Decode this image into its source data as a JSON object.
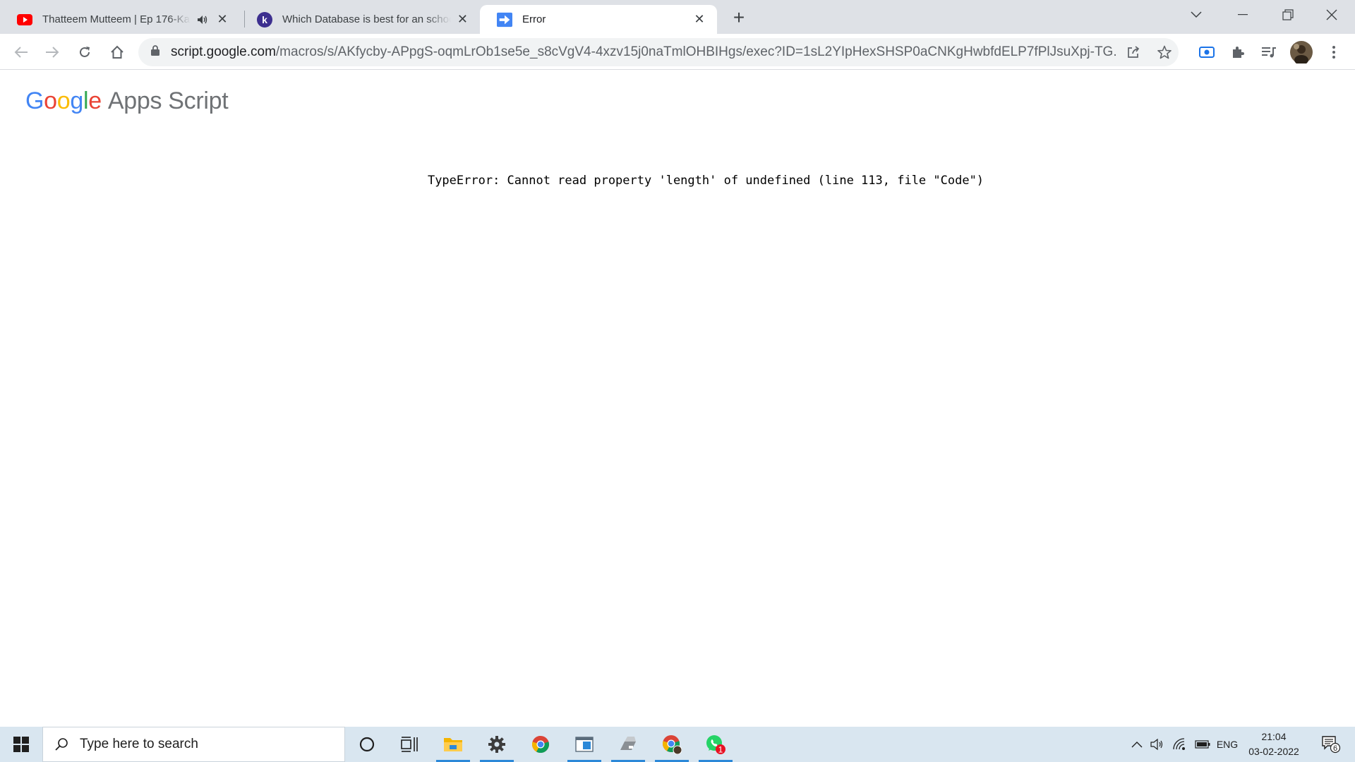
{
  "browser": {
    "tabs": [
      {
        "title": "Thatteem Mutteem | Ep 176-Ka",
        "favicon": "youtube-icon",
        "audio": true,
        "active": false
      },
      {
        "title": "Which Database is best for an school",
        "favicon": "k-letter-icon",
        "active": false
      },
      {
        "title": "Error",
        "favicon": "apps-script-arrow-icon",
        "active": true
      }
    ],
    "new_tab_label": "+",
    "address": {
      "host": "script.google.com",
      "path": "/macros/s/AKfycby-APpgS-oqmLrOb1se5e_s8cVgV4-4xzv15j0naTmlOHBIHgs/exec?ID=1sL2YIpHexSHSP0aCNKgHwbfdELP7fPlJsuXpj-TG..."
    }
  },
  "page": {
    "logo_google": [
      "G",
      "o",
      "o",
      "g",
      "l",
      "e"
    ],
    "logo_product": "Apps Script",
    "error_message": "TypeError: Cannot read property 'length' of undefined (line 113, file \"Code\")"
  },
  "taskbar": {
    "search_placeholder": "Type here to search",
    "pinned": [
      "cortana-icon",
      "task-view-icon",
      "file-explorer-icon",
      "settings-icon",
      "chrome-icon",
      "app-window-icon",
      "drive-app-icon",
      "chrome-profile-icon",
      "whatsapp-icon"
    ],
    "whatsapp_badge": "1",
    "language": "ENG",
    "time": "21:04",
    "date": "03-02-2022",
    "notification_count": "6"
  },
  "colors": {
    "tabstrip_bg": "#dee1e6",
    "omnibox_bg": "#f1f3f4",
    "taskbar_bg": "#d9e6f0",
    "accent_blue": "#1a73e8"
  }
}
